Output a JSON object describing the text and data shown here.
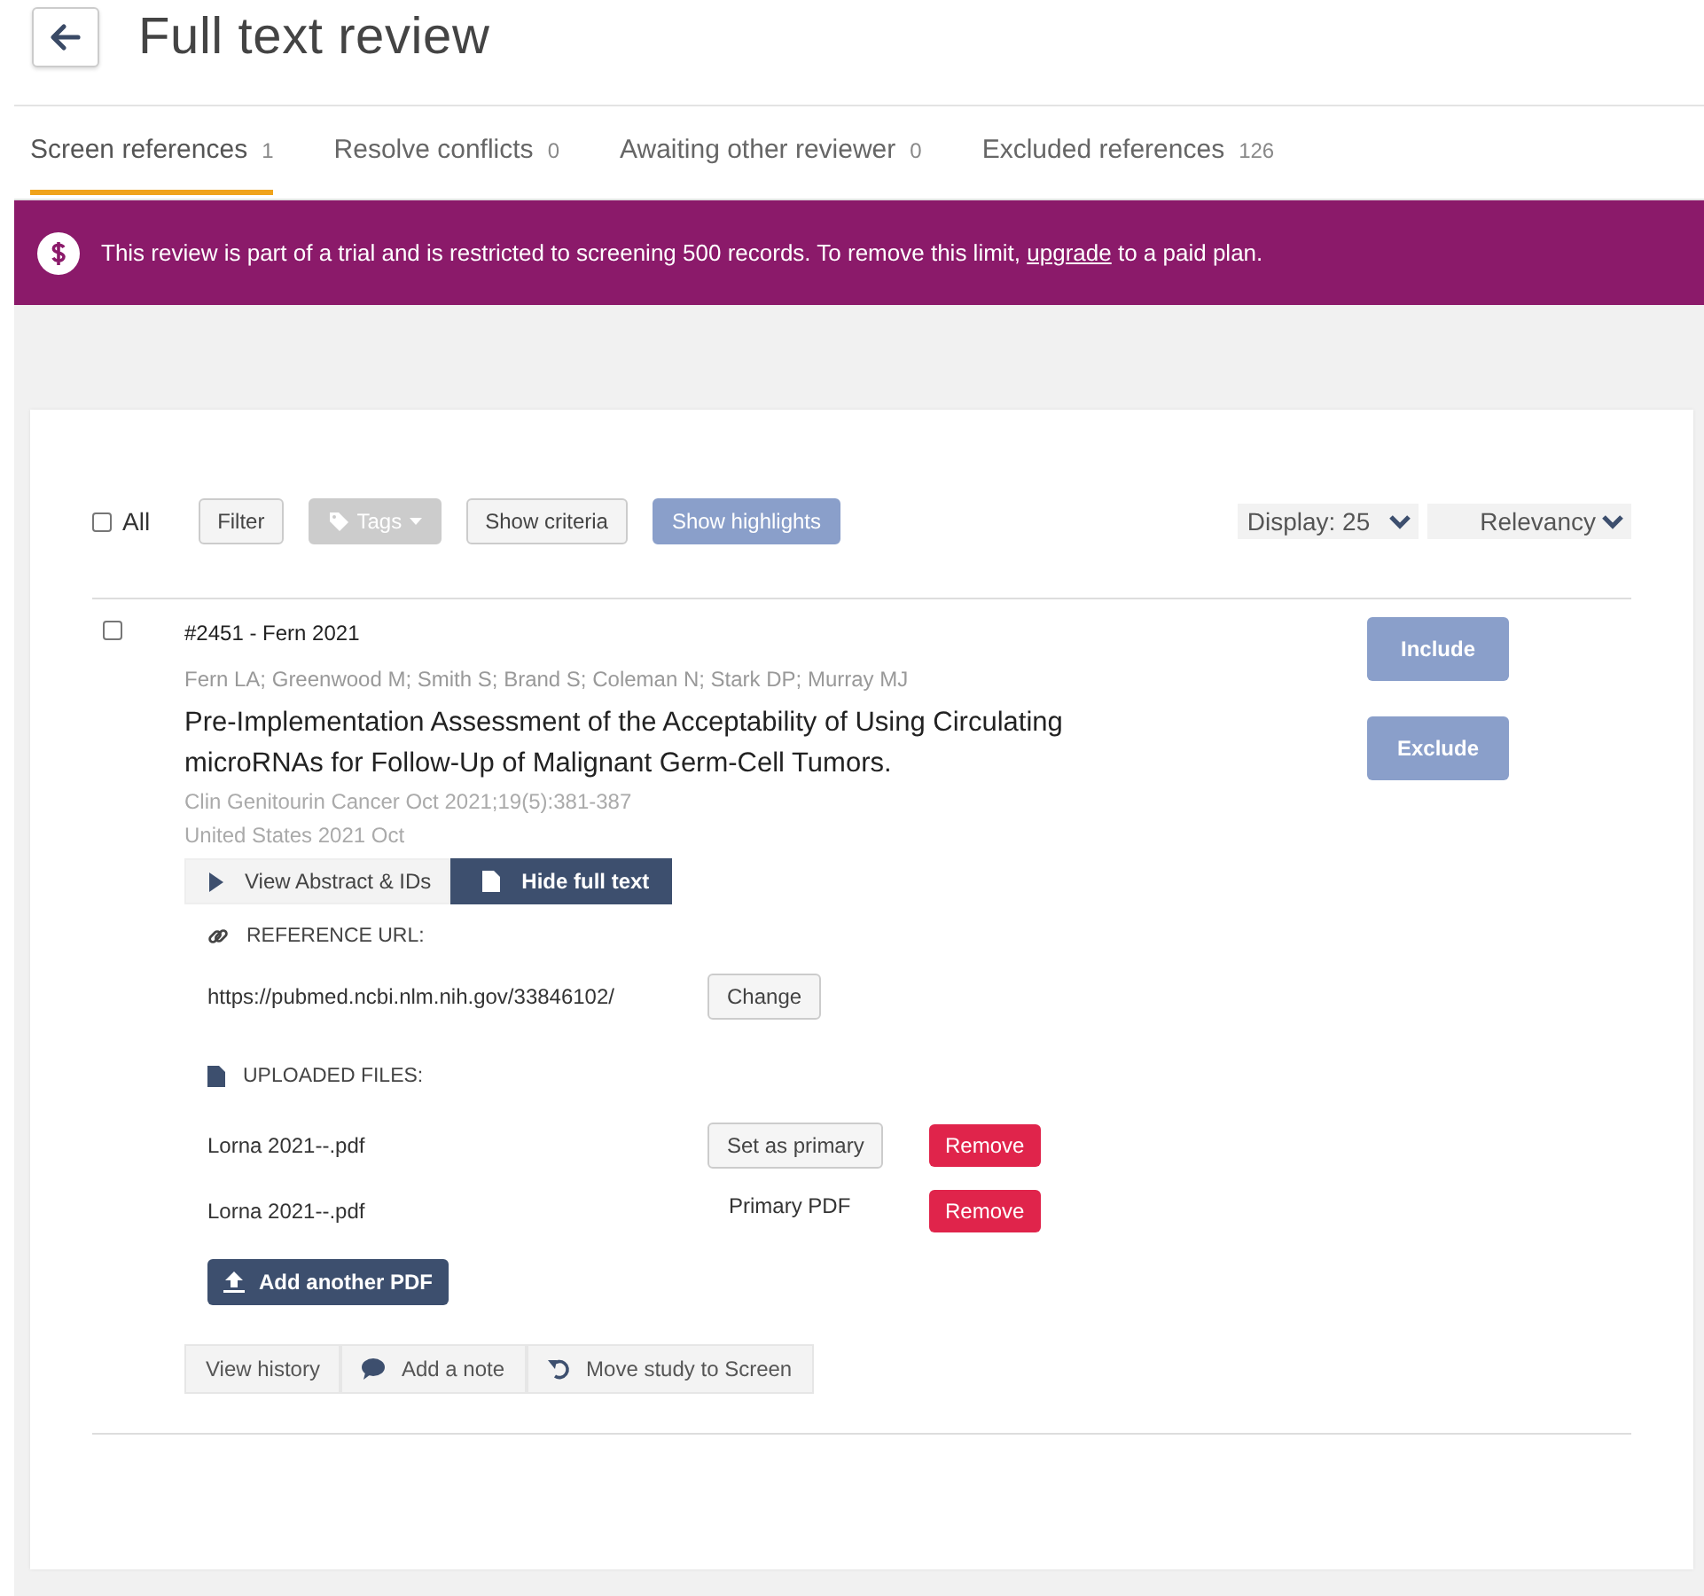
{
  "header": {
    "title": "Full text review"
  },
  "tabs": [
    {
      "label": "Screen references",
      "count": "1",
      "selected": true
    },
    {
      "label": "Resolve conflicts",
      "count": "0",
      "selected": false
    },
    {
      "label": "Awaiting other reviewer",
      "count": "0",
      "selected": false
    },
    {
      "label": "Excluded references",
      "count": "126",
      "selected": false
    }
  ],
  "banner": {
    "text": "This review is part of a trial and is restricted to screening 500 records. To remove this limit, ",
    "link": "upgrade",
    "text_after": " to a paid plan."
  },
  "toolbar": {
    "select_all": {
      "label": "All",
      "checked": false
    },
    "buttons": [
      {
        "label": "Filter",
        "kind": "default"
      },
      {
        "label": "Tags",
        "kind": "disabled"
      },
      {
        "label": "Show criteria",
        "kind": "default"
      },
      {
        "label": "Show highlights",
        "kind": "primary"
      }
    ],
    "display": "Display: 25",
    "sort": "Relevancy"
  },
  "reference": {
    "checked": false,
    "id_line": "#2451 - Fern 2021",
    "authors": "Fern LA; Greenwood M; Smith S; Brand S; Coleman N; Stark DP; Murray MJ",
    "title": "Pre-Implementation Assessment of the Acceptability of Using Circulating microRNAs for Follow-Up of Malignant Germ-Cell Tumors.",
    "journal": "Clin Genitourin Cancer Oct 2021;19(5):381-387",
    "country_date": "United States 2021 Oct",
    "decisions": [
      "Include",
      "Exclude"
    ],
    "view_tabs": [
      {
        "label": "View Abstract & IDs",
        "kind": "play",
        "selected": false
      },
      {
        "label": "Hide full text",
        "kind": "doc",
        "selected": true
      }
    ],
    "url_label": "REFERENCE URL:",
    "url": "https://pubmed.ncbi.nlm.nih.gov/33846102/",
    "change": "Change",
    "files_label": "UPLOADED FILES:",
    "files": [
      {
        "name": "Lorna 2021--.pdf",
        "primary": false,
        "action": "Set as primary",
        "remove": "Remove"
      },
      {
        "name": "Lorna 2021--.pdf",
        "primary": true,
        "action": "Primary PDF",
        "remove": "Remove"
      }
    ],
    "add_pdf": "Add another PDF",
    "footer_buttons": [
      {
        "label": "View history",
        "kind": "plain"
      },
      {
        "label": "Add a note",
        "kind": "comment"
      },
      {
        "label": "Move study to Screen",
        "kind": "undo"
      }
    ]
  }
}
